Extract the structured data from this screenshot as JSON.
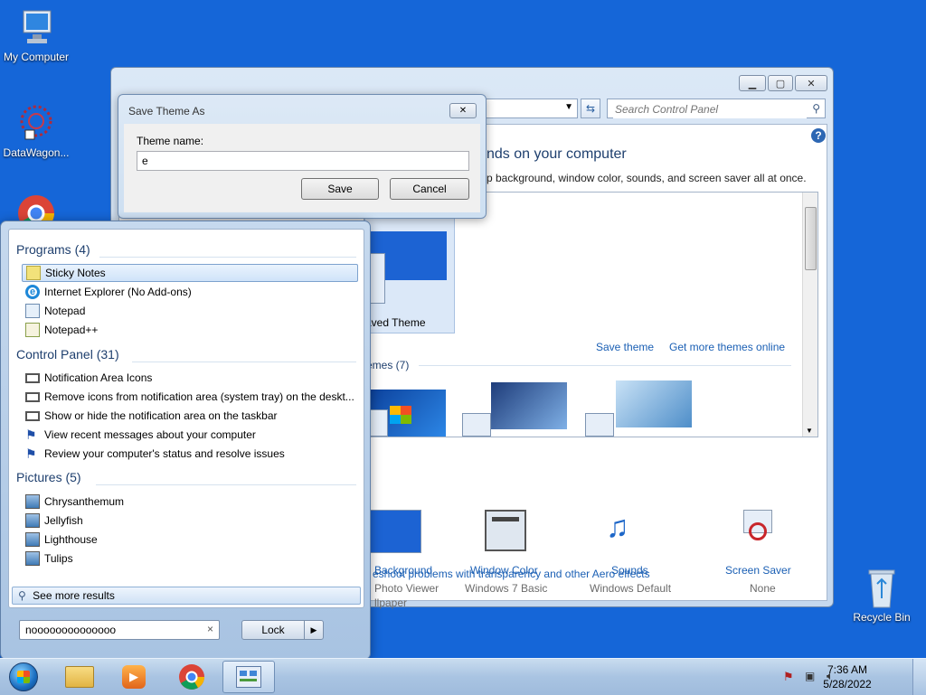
{
  "desktop": {
    "icons": [
      {
        "label": "My Computer"
      },
      {
        "label": "DataWagon..."
      },
      {
        "label": "Recycle Bin"
      }
    ]
  },
  "control_panel": {
    "search_placeholder": "Search Control Panel",
    "heading_partial": "nds on your computer",
    "subtitle_partial": "p background, window color, sounds, and screen saver all at once.",
    "unsaved_theme": "aved Theme",
    "save_theme": "Save theme",
    "get_more": "Get more themes online",
    "themes_count": "emes (7)",
    "items": [
      {
        "label": "Background",
        "sub1": "Photo Viewer",
        "sub2": "llpaper"
      },
      {
        "label": "Window Color",
        "sub1": "Windows 7 Basic"
      },
      {
        "label": "Sounds",
        "sub1": "Windows Default"
      },
      {
        "label": "Screen Saver",
        "sub1": "None"
      }
    ],
    "troubleshoot": "eshoot problems with transparency and other Aero effects"
  },
  "save_dialog": {
    "title": "Save Theme As",
    "name_label": "Theme name:",
    "name_value": "e",
    "save": "Save",
    "cancel": "Cancel"
  },
  "start_menu": {
    "programs_header": "Programs (4)",
    "programs": [
      "Sticky Notes",
      "Internet Explorer (No Add-ons)",
      "Notepad",
      "Notepad++"
    ],
    "control_header": "Control Panel (31)",
    "control": [
      "Notification Area Icons",
      "Remove icons from notification area (system tray) on the deskt...",
      "Show or hide the notification area on the taskbar",
      "View recent messages about your computer",
      "Review your computer's status and resolve issues"
    ],
    "pictures_header": "Pictures (5)",
    "pictures": [
      "Chrysanthemum",
      "Jellyfish",
      "Lighthouse",
      "Tulips"
    ],
    "see_more": "See more results",
    "search_value": "noooooooooooooo",
    "lock": "Lock"
  },
  "taskbar": {
    "time": "7:36 AM",
    "date": "5/28/2022"
  }
}
